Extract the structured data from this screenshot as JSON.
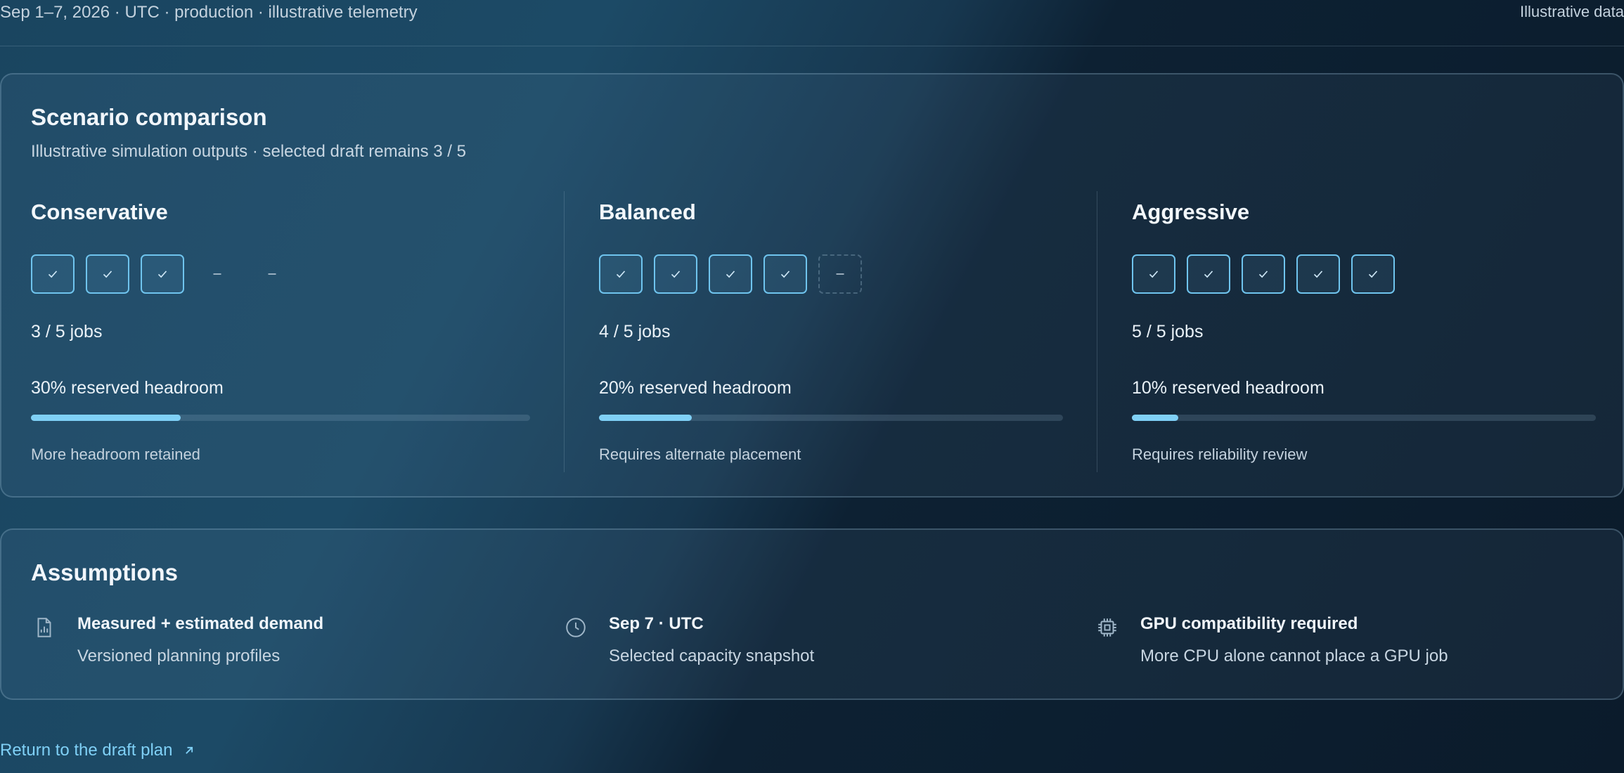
{
  "header": {
    "meta": "Sep 1–7, 2026 · UTC · production · illustrative telemetry",
    "badge": "Illustrative data"
  },
  "scenario_card": {
    "title": "Scenario comparison",
    "subtitle": "Illustrative simulation outputs · selected draft remains 3 / 5",
    "scenarios": [
      {
        "name": "Conservative",
        "jobs_placed": 3,
        "jobs_total": 5,
        "jobs_label": "3 / 5 jobs",
        "headroom_label": "30% reserved headroom",
        "headroom_fraction": 0.3,
        "note": "More headroom retained"
      },
      {
        "name": "Balanced",
        "jobs_placed": 4,
        "jobs_total": 5,
        "jobs_label": "4 / 5 jobs",
        "headroom_label": "20% reserved headroom",
        "headroom_fraction": 0.2,
        "note": "Requires alternate placement"
      },
      {
        "name": "Aggressive",
        "jobs_placed": 5,
        "jobs_total": 5,
        "jobs_label": "5 / 5 jobs",
        "headroom_label": "10% reserved headroom",
        "headroom_fraction": 0.1,
        "note": "Requires reliability review"
      }
    ]
  },
  "assumptions": {
    "title": "Assumptions",
    "items": [
      {
        "icon": "document-chart-icon",
        "title": "Measured + estimated demand",
        "desc": "Versioned planning profiles"
      },
      {
        "icon": "clock-icon",
        "title": "Sep 7 · UTC",
        "desc": "Selected capacity snapshot"
      },
      {
        "icon": "cpu-chip-icon",
        "title": "GPU compatibility required",
        "desc": "More CPU alone cannot place a GPU job"
      }
    ]
  },
  "footer": {
    "return_label": "Return to the draft plan",
    "return_icon": "arrow-up-right-icon"
  },
  "colors": {
    "accent": "#7fd0f6",
    "slot_border": "#6fc4ee"
  }
}
